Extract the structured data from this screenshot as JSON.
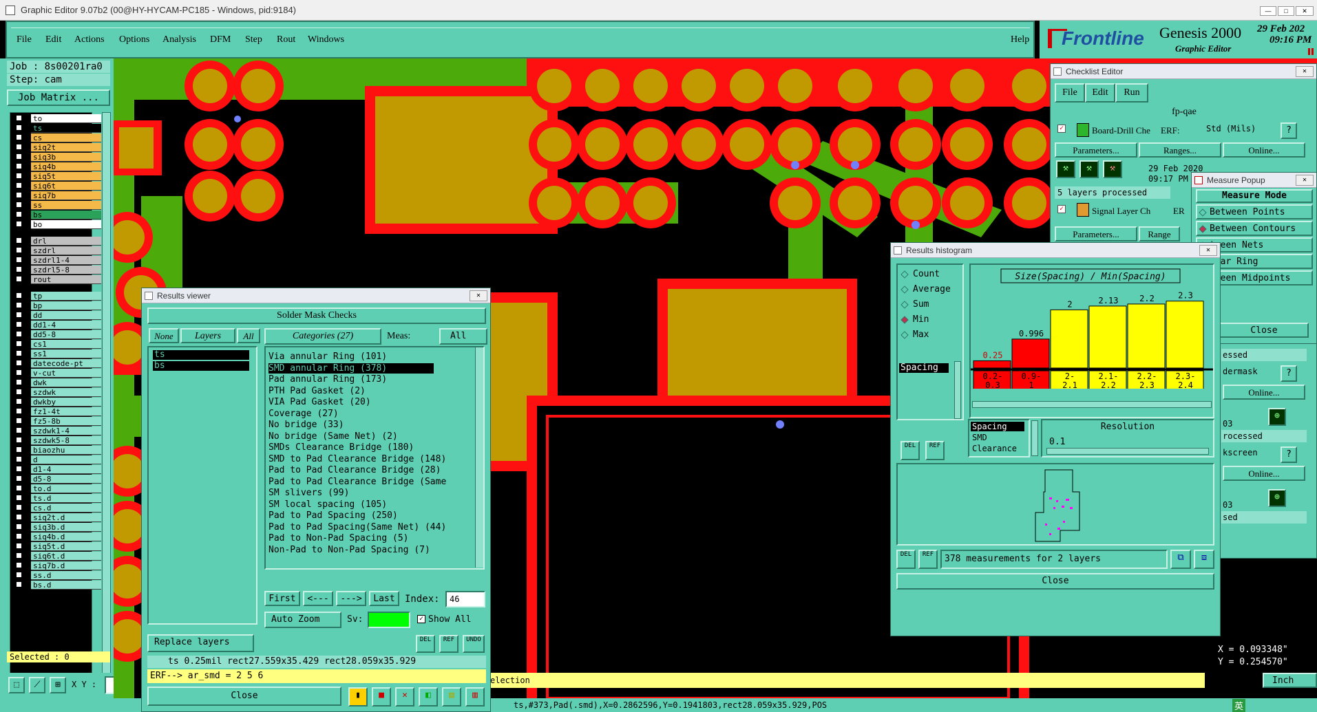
{
  "window": {
    "title": "Graphic Editor 9.07b2 (00@HY-HYCAM-PC185 - Windows, pid:9184)",
    "controls": [
      "—",
      "□",
      "✕"
    ]
  },
  "menu": {
    "items": [
      "File",
      "Edit",
      "Actions",
      "Options",
      "Analysis",
      "DFM",
      "Step",
      "Rout",
      "Windows"
    ],
    "help": "Help"
  },
  "brand": {
    "logo": "Frontline",
    "product": "Genesis 2000",
    "subtitle": "Graphic Editor",
    "date": "29 Feb 202",
    "time": "09:16 PM"
  },
  "job": {
    "job": "Job : 8s00201ra0",
    "step": "Step: cam",
    "matrix": "Job Matrix ..."
  },
  "layers": [
    {
      "name": "to",
      "color": "#ffffff"
    },
    {
      "name": "ts",
      "color": "#000000",
      "fg": "#5fcfb4"
    },
    {
      "name": "cs",
      "color": "#f5b94a"
    },
    {
      "name": "siq2t",
      "color": "#f5b94a"
    },
    {
      "name": "siq3b",
      "color": "#f5b94a"
    },
    {
      "name": "siq4b",
      "color": "#f5b94a"
    },
    {
      "name": "siq5t",
      "color": "#f5b94a"
    },
    {
      "name": "siq6t",
      "color": "#f5b94a"
    },
    {
      "name": "siq7b",
      "color": "#f5b94a"
    },
    {
      "name": "ss",
      "color": "#f5b94a"
    },
    {
      "name": "bs",
      "color": "#2aa25a"
    },
    {
      "name": "bo",
      "color": "#ffffff"
    },
    {
      "name": "drl",
      "color": "#c0c0c0"
    },
    {
      "name": "szdrl",
      "color": "#c0c0c0"
    },
    {
      "name": "szdrl1-4",
      "color": "#c0c0c0"
    },
    {
      "name": "szdrl5-8",
      "color": "#c0c0c0"
    },
    {
      "name": "rout",
      "color": "#c0c0c0"
    },
    {
      "name": "tp",
      "color": "#8fe0cc"
    },
    {
      "name": "bp",
      "color": "#8fe0cc"
    },
    {
      "name": "dd",
      "color": "#8fe0cc"
    },
    {
      "name": "dd1-4",
      "color": "#8fe0cc"
    },
    {
      "name": "dd5-8",
      "color": "#8fe0cc"
    },
    {
      "name": "cs1",
      "color": "#8fe0cc"
    },
    {
      "name": "ss1",
      "color": "#8fe0cc"
    },
    {
      "name": "datecode-pt",
      "color": "#8fe0cc"
    },
    {
      "name": "v-cut",
      "color": "#8fe0cc"
    },
    {
      "name": "dwk",
      "color": "#8fe0cc"
    },
    {
      "name": "szdwk",
      "color": "#8fe0cc"
    },
    {
      "name": "dwkby",
      "color": "#8fe0cc"
    },
    {
      "name": "fz1-4t",
      "color": "#8fe0cc"
    },
    {
      "name": "fz5-8b",
      "color": "#8fe0cc"
    },
    {
      "name": "szdwk1-4",
      "color": "#8fe0cc"
    },
    {
      "name": "szdwk5-8",
      "color": "#8fe0cc"
    },
    {
      "name": "biaozhu",
      "color": "#8fe0cc"
    },
    {
      "name": "d",
      "color": "#8fe0cc"
    },
    {
      "name": "d1-4",
      "color": "#8fe0cc"
    },
    {
      "name": "d5-8",
      "color": "#8fe0cc"
    },
    {
      "name": "to.d",
      "color": "#8fe0cc"
    },
    {
      "name": "ts.d",
      "color": "#8fe0cc"
    },
    {
      "name": "cs.d",
      "color": "#8fe0cc"
    },
    {
      "name": "siq2t.d",
      "color": "#8fe0cc"
    },
    {
      "name": "siq3b.d",
      "color": "#8fe0cc"
    },
    {
      "name": "siq4b.d",
      "color": "#8fe0cc"
    },
    {
      "name": "siq5t.d",
      "color": "#8fe0cc"
    },
    {
      "name": "siq6t.d",
      "color": "#8fe0cc"
    },
    {
      "name": "siq7b.d",
      "color": "#8fe0cc"
    },
    {
      "name": "ss.d",
      "color": "#8fe0cc"
    },
    {
      "name": "bs.d",
      "color": "#8fe0cc"
    }
  ],
  "selected": "Selected : 0",
  "xy_label": "X Y :",
  "status": {
    "selection": "election",
    "bottom": "ts,#373,Pad(.smd),X=0.2862596,Y=0.1941803,rect28.059x35.929,POS",
    "x": "X = 0.093348\"",
    "y": "Y = 0.254570\"",
    "units": "Inch"
  },
  "results_viewer": {
    "title": "Results viewer",
    "heading": "Solder Mask Checks",
    "none": "None",
    "layers": "Layers",
    "all": "All",
    "categories": "Categories (27)",
    "meas": "Meas:",
    "meas_value": "All",
    "layer_items": [
      "ts",
      "bs"
    ],
    "category_items": [
      "Via annular Ring (101)",
      "SMD annular Ring (378)",
      "Pad annular Ring (173)",
      "PTH Pad Gasket (2)",
      "VIA Pad Gasket (20)",
      "Coverage (27)",
      "No bridge (33)",
      "No bridge (Same Net) (2)",
      "SMDs Clearance Bridge (180)",
      "SMD to Pad Clearance Bridge (148)",
      "Pad to Pad Clearance Bridge (28)",
      "Pad to Pad Clearance Bridge (Same",
      "SM slivers (99)",
      "SM local spacing (105)",
      "Pad to Pad Spacing (250)",
      "Pad to Pad Spacing(Same Net) (44)",
      "Pad to Non-Pad Spacing (5)",
      "Non-Pad to Non-Pad Spacing (7)"
    ],
    "selected_category": 1,
    "first": "First",
    "prev": "<---",
    "next": "--->",
    "last": "Last",
    "index_label": "Index:",
    "index_value": "46",
    "auto_zoom": "Auto Zoom",
    "sv": "Sv:",
    "show_all": "Show All",
    "replace_layers": "Replace layers",
    "del": "DEL",
    "ref": "REF",
    "undo": "UNDO",
    "info": "ts 0.25mil  rect27.559x35.429  rect28.059x35.929",
    "erf": "ERF--> ar_smd = 2 5 6",
    "close": "Close"
  },
  "checklist": {
    "title": "Checklist Editor",
    "menu": [
      "File",
      "Edit",
      "Run"
    ],
    "name": "fp-qae",
    "row1": "Board-Drill Che",
    "erf": "ERF:",
    "std": "Std (Mils)",
    "parameters": "Parameters...",
    "ranges": "Ranges...",
    "online": "Online...",
    "date": "29 Feb 2020",
    "time": "09:17 PM",
    "processed": "5 layers processed",
    "row2": "Signal Layer Ch",
    "erf2": "ER",
    "ranges2": "Range",
    "frag": [
      "essed",
      "dermask",
      "Online...",
      "03",
      "rocessed",
      "kscreen",
      "Online...",
      "03",
      "sed"
    ]
  },
  "measure": {
    "title": "Measure Popup",
    "mode": "Measure Mode",
    "items": [
      "Between Points",
      "Between Contours",
      "tween Nets",
      "ular Ring",
      "tween Midpoints"
    ],
    "selected": 1,
    "close": "Close"
  },
  "histogram": {
    "title": "Results histogram",
    "options": [
      "Count",
      "Average",
      "Sum",
      "Min",
      "Max"
    ],
    "selected_option": 3,
    "chart_title": "Size(Spacing) / Min(Spacing)",
    "spacing": "Spacing",
    "list": [
      "Spacing",
      "SMD",
      "Clearance"
    ],
    "resolution_label": "Resolution",
    "resolution": "0.1",
    "summary": "378 measurements for 2 layers",
    "close": "Close",
    "del": "DEL",
    "ref": "REF"
  },
  "chart_data": {
    "type": "bar",
    "title": "Size(Spacing) / Min(Spacing)",
    "categories": [
      "0.2-0.3",
      "0.9-1",
      "2-2.1",
      "2.1-2.2",
      "2.2-2.3",
      "2.3-2.4"
    ],
    "values": [
      0.25,
      0.996,
      2,
      2.13,
      2.2,
      2.3
    ],
    "value_labels": [
      "0.25",
      "0.996",
      "2",
      "2.13",
      "2.2",
      "2.3"
    ],
    "category_labels": [
      [
        "0.2-",
        "0.3"
      ],
      [
        "0.9-",
        "1"
      ],
      [
        "2-",
        "2.1"
      ],
      [
        "2.1-",
        "2.2"
      ],
      [
        "2.2-",
        "2.3"
      ],
      [
        "2.3-",
        "2.4"
      ]
    ],
    "colors": [
      "#ff0000",
      "#ff0000",
      "#ffff00",
      "#ffff00",
      "#ffff00",
      "#ffff00"
    ],
    "ylim": [
      0,
      2.6
    ]
  },
  "tray": {
    "ime": "英"
  }
}
